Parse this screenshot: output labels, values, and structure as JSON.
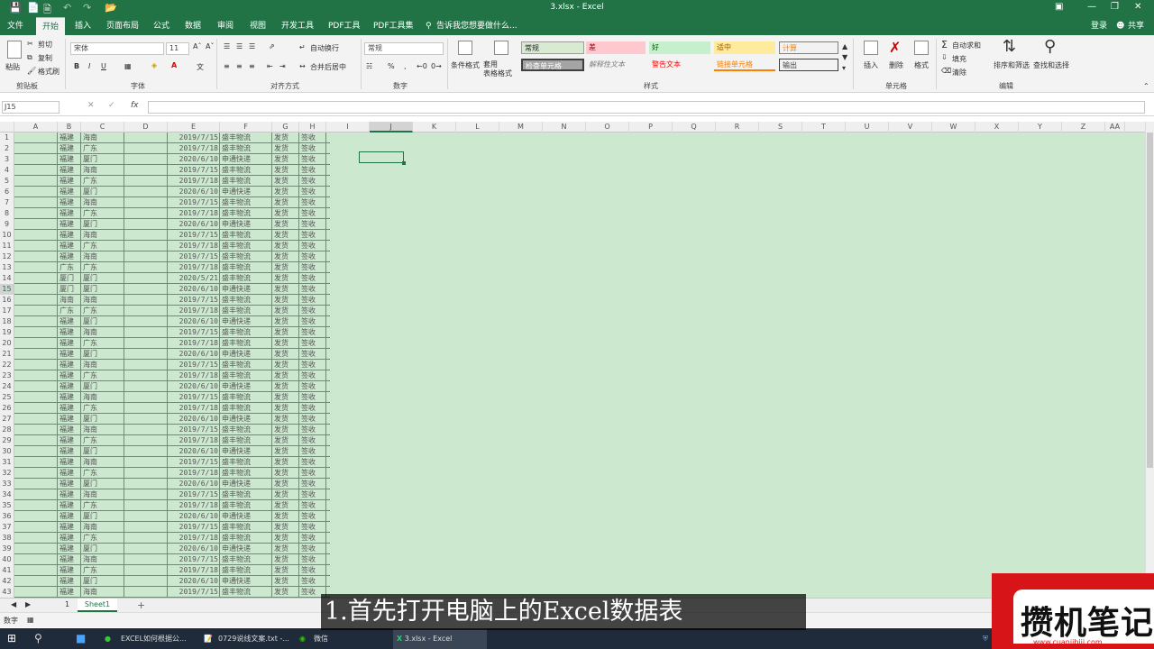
{
  "window": {
    "title": "3.xlsx - Excel",
    "quick_access": [
      "save-icon",
      "new-icon",
      "open-icon",
      "undo-icon",
      "redo-icon",
      "folder-icon"
    ],
    "controls": [
      "ribbon-display-icon",
      "minimize-icon",
      "restore-icon",
      "close-icon"
    ]
  },
  "tabs": [
    "文件",
    "开始",
    "插入",
    "页面布局",
    "公式",
    "数据",
    "审阅",
    "视图",
    "开发工具",
    "PDF工具",
    "PDF工具集"
  ],
  "tell_me": "告诉我您想要做什么...",
  "account": {
    "login": "登录",
    "share": "共享"
  },
  "ribbon": {
    "clipboard": {
      "paste": "粘贴",
      "cut": "剪切",
      "copy": "复制",
      "format_painter": "格式刷",
      "group": "剪贴板"
    },
    "font": {
      "name": "宋体",
      "size": "11",
      "bold": "B",
      "italic": "I",
      "underline": "U",
      "group": "字体"
    },
    "alignment": {
      "wrap": "自动换行",
      "merge": "合并后居中",
      "group": "对齐方式"
    },
    "number": {
      "format": "常规",
      "percent": "%",
      "comma": ",",
      "group": "数字"
    },
    "styles": {
      "conditional": "条件格式",
      "table": "套用\n表格格式",
      "cells": [
        "常规",
        "差",
        "好",
        "适中",
        "计算",
        "检查单元格",
        "解释性文本",
        "警告文本",
        "链接单元格",
        "输出"
      ],
      "colors": [
        "#d9ead3",
        "#ffc7ce",
        "#c6efce",
        "#ffeb9c",
        "#f2f2f2",
        "#a5a5a5",
        "#ffffff",
        "#ffffff",
        "#ffffff",
        "#f2f2f2"
      ],
      "group": "样式"
    },
    "cells_group": {
      "insert": "插入",
      "delete": "删除",
      "format": "格式",
      "group": "单元格"
    },
    "editing": {
      "autosum": "自动求和",
      "fill": "填充",
      "clear": "清除",
      "sort": "排序和筛选",
      "find": "查找和选择",
      "group": "编辑"
    }
  },
  "formula_bar": {
    "name_box": "J15",
    "cancel": "✕",
    "enter": "✓",
    "fx": "fx",
    "value": ""
  },
  "columns": [
    "A",
    "B",
    "C",
    "D",
    "E",
    "F",
    "G",
    "H",
    "I",
    "J",
    "K",
    "L",
    "M",
    "N",
    "O",
    "P",
    "Q",
    "R",
    "S",
    "T",
    "U",
    "V",
    "W",
    "X",
    "Y",
    "Z",
    "AA"
  ],
  "selected_cell": "J15",
  "rows": [
    [
      "福建",
      "海南",
      "2019/7/15",
      "盛丰物流",
      "发货",
      "签收"
    ],
    [
      "福建",
      "广东",
      "2019/7/18",
      "盛丰物流",
      "发货",
      "签收"
    ],
    [
      "福建",
      "厦门",
      "2020/6/10",
      "申通快递",
      "发货",
      "签收"
    ],
    [
      "福建",
      "海南",
      "2019/7/15",
      "盛丰物流",
      "发货",
      "签收"
    ],
    [
      "福建",
      "广东",
      "2019/7/18",
      "盛丰物流",
      "发货",
      "签收"
    ],
    [
      "福建",
      "厦门",
      "2020/6/10",
      "申通快递",
      "发货",
      "签收"
    ],
    [
      "福建",
      "海南",
      "2019/7/15",
      "盛丰物流",
      "发货",
      "签收"
    ],
    [
      "福建",
      "广东",
      "2019/7/18",
      "盛丰物流",
      "发货",
      "签收"
    ],
    [
      "福建",
      "厦门",
      "2020/6/10",
      "申通快递",
      "发货",
      "签收"
    ],
    [
      "福建",
      "海南",
      "2019/7/15",
      "盛丰物流",
      "发货",
      "签收"
    ],
    [
      "福建",
      "广东",
      "2019/7/18",
      "盛丰物流",
      "发货",
      "签收"
    ],
    [
      "福建",
      "海南",
      "2019/7/15",
      "盛丰物流",
      "发货",
      "签收"
    ],
    [
      "广东",
      "广东",
      "2019/7/18",
      "盛丰物流",
      "发货",
      "签收"
    ],
    [
      "厦门",
      "厦门",
      "2020/5/21",
      "盛丰物流",
      "发货",
      "签收"
    ],
    [
      "厦门",
      "厦门",
      "2020/6/10",
      "申通快递",
      "发货",
      "签收"
    ],
    [
      "海南",
      "海南",
      "2019/7/15",
      "盛丰物流",
      "发货",
      "签收"
    ],
    [
      "广东",
      "广东",
      "2019/7/18",
      "盛丰物流",
      "发货",
      "签收"
    ],
    [
      "福建",
      "厦门",
      "2020/6/10",
      "申通快递",
      "发货",
      "签收"
    ],
    [
      "福建",
      "海南",
      "2019/7/15",
      "盛丰物流",
      "发货",
      "签收"
    ],
    [
      "福建",
      "广东",
      "2019/7/18",
      "盛丰物流",
      "发货",
      "签收"
    ],
    [
      "福建",
      "厦门",
      "2020/6/10",
      "申通快递",
      "发货",
      "签收"
    ],
    [
      "福建",
      "海南",
      "2019/7/15",
      "盛丰物流",
      "发货",
      "签收"
    ],
    [
      "福建",
      "广东",
      "2019/7/18",
      "盛丰物流",
      "发货",
      "签收"
    ],
    [
      "福建",
      "厦门",
      "2020/6/10",
      "申通快递",
      "发货",
      "签收"
    ],
    [
      "福建",
      "海南",
      "2019/7/15",
      "盛丰物流",
      "发货",
      "签收"
    ],
    [
      "福建",
      "广东",
      "2019/7/18",
      "盛丰物流",
      "发货",
      "签收"
    ],
    [
      "福建",
      "厦门",
      "2020/6/10",
      "申通快递",
      "发货",
      "签收"
    ],
    [
      "福建",
      "海南",
      "2019/7/15",
      "盛丰物流",
      "发货",
      "签收"
    ],
    [
      "福建",
      "广东",
      "2019/7/18",
      "盛丰物流",
      "发货",
      "签收"
    ],
    [
      "福建",
      "厦门",
      "2020/6/10",
      "申通快递",
      "发货",
      "签收"
    ],
    [
      "福建",
      "海南",
      "2019/7/15",
      "盛丰物流",
      "发货",
      "签收"
    ],
    [
      "福建",
      "广东",
      "2019/7/18",
      "盛丰物流",
      "发货",
      "签收"
    ],
    [
      "福建",
      "厦门",
      "2020/6/10",
      "申通快递",
      "发货",
      "签收"
    ],
    [
      "福建",
      "海南",
      "2019/7/15",
      "盛丰物流",
      "发货",
      "签收"
    ],
    [
      "福建",
      "广东",
      "2019/7/18",
      "盛丰物流",
      "发货",
      "签收"
    ],
    [
      "福建",
      "厦门",
      "2020/6/10",
      "申通快递",
      "发货",
      "签收"
    ],
    [
      "福建",
      "海南",
      "2019/7/15",
      "盛丰物流",
      "发货",
      "签收"
    ],
    [
      "福建",
      "广东",
      "2019/7/18",
      "盛丰物流",
      "发货",
      "签收"
    ],
    [
      "福建",
      "厦门",
      "2020/6/10",
      "申通快递",
      "发货",
      "签收"
    ],
    [
      "福建",
      "海南",
      "2019/7/15",
      "盛丰物流",
      "发货",
      "签收"
    ],
    [
      "福建",
      "广东",
      "2019/7/18",
      "盛丰物流",
      "发货",
      "签收"
    ],
    [
      "福建",
      "厦门",
      "2020/6/10",
      "申通快递",
      "发货",
      "签收"
    ],
    [
      "福建",
      "海南",
      "2019/7/15",
      "盛丰物流",
      "发货",
      "签收"
    ]
  ],
  "sheets": {
    "nav": "1",
    "active": "Sheet1",
    "add": "+"
  },
  "status": {
    "mode": "数字"
  },
  "taskbar": {
    "items": [
      "EXCEL如何根据公...",
      "0729说线文案.txt -...",
      "微信",
      "3.xlsx - Excel"
    ]
  },
  "caption": "1.首先打开电脑上的Excel数据表",
  "watermark": {
    "text": "攒机笔记",
    "url": "www.cuanjibiji.com"
  }
}
